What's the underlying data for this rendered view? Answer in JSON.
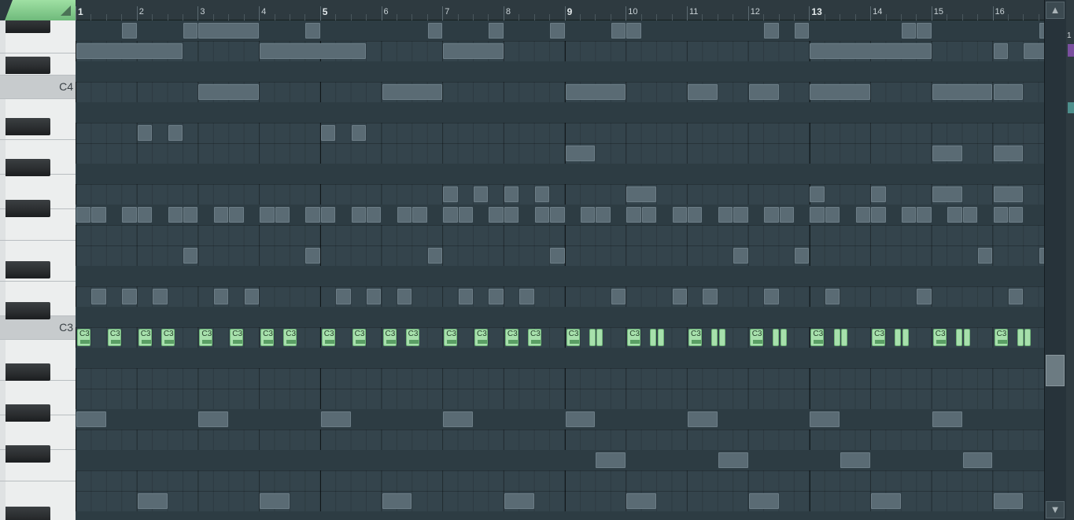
{
  "ruler": {
    "bars": [
      "1",
      "2",
      "3",
      "4",
      "5",
      "6",
      "7",
      "8",
      "9",
      "10",
      "11",
      "12",
      "13",
      "14",
      "15",
      "16"
    ]
  },
  "keyboard": {
    "labels": {
      "c4": "C4",
      "c3": "C3"
    }
  },
  "notes": {
    "label": "C3"
  },
  "scrollbar": {
    "up_glyph": "▲",
    "down_glyph": "▼"
  },
  "side_panel": {
    "number": "1"
  }
}
